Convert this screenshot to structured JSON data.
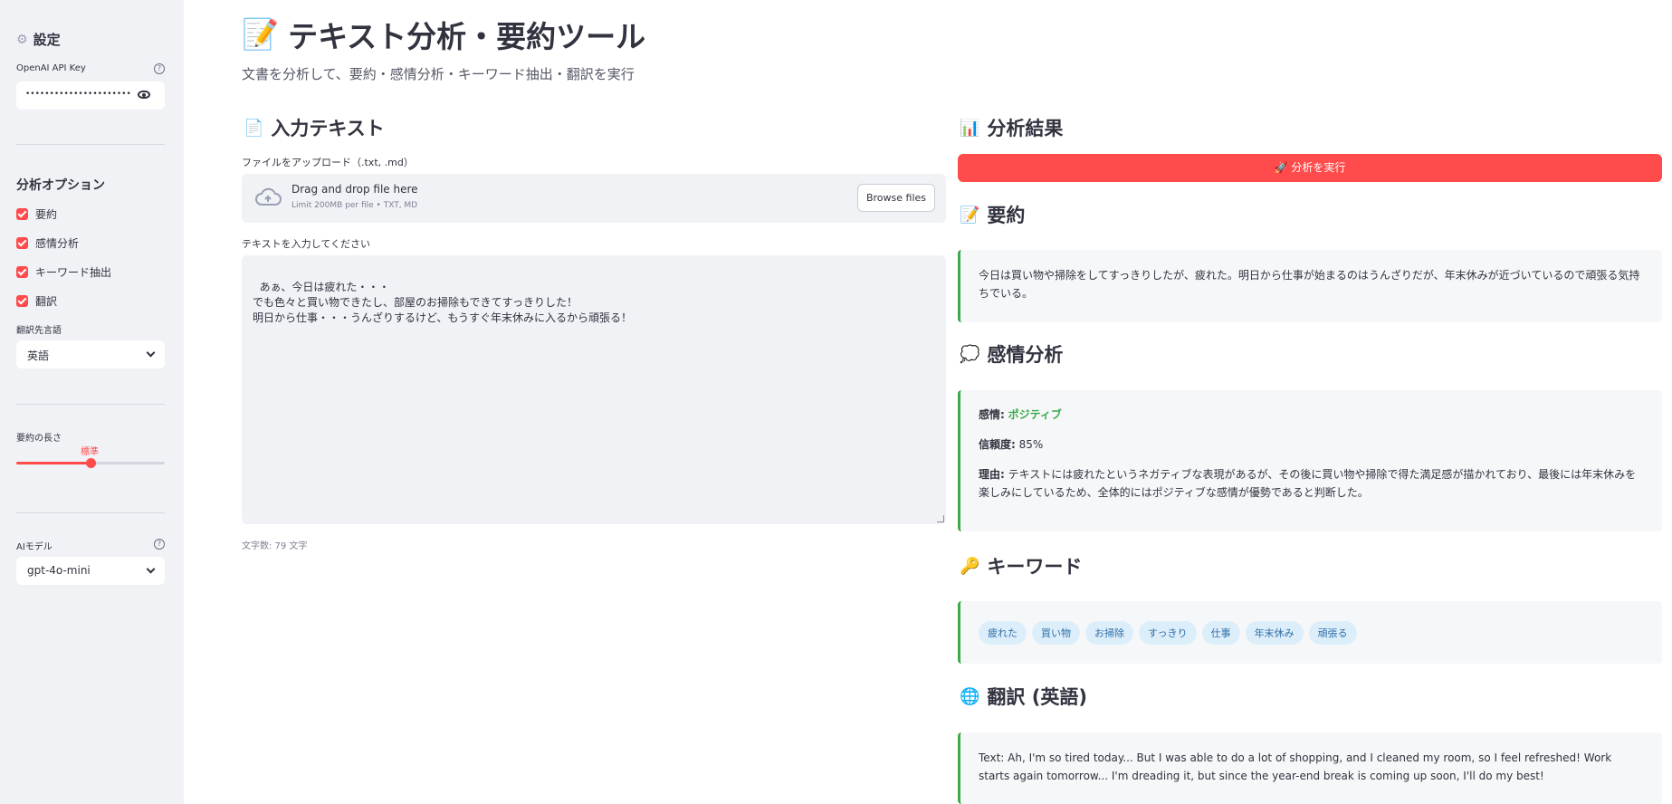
{
  "sidebar": {
    "title": "設定",
    "title_icon": "gear-icon",
    "api_key_label": "OpenAI API Key",
    "api_key_value": "••••••••••••••••••••••••••••••••",
    "help_glyph": "?",
    "options_heading": "分析オプション",
    "options": [
      {
        "label": "要約",
        "checked": true
      },
      {
        "label": "感情分析",
        "checked": true
      },
      {
        "label": "キーワード抽出",
        "checked": true
      },
      {
        "label": "翻訳",
        "checked": true
      }
    ],
    "target_lang_label": "翻訳先言語",
    "target_lang_value": "英語",
    "summary_length_label": "要約の長さ",
    "summary_length_value": "標準",
    "summary_length_position": 0.5,
    "model_label": "AIモデル",
    "model_value": "gpt-4o-mini"
  },
  "main": {
    "title_icon": "📝",
    "title": "テキスト分析・要約ツール",
    "subtitle": "文書を分析して、要約・感情分析・キーワード抽出・翻訳を実行",
    "input_heading_icon": "📄",
    "input_heading": "入力テキスト",
    "upload_label": "ファイルをアップロード（.txt, .md）",
    "dropzone_main": "Drag and drop file here",
    "dropzone_sub": "Limit 200MB per file • TXT, MD",
    "browse_button": "Browse files",
    "textarea_label": "テキストを入力してください",
    "textarea_value": "あぁ、今日は疲れた・・・\nでも色々と買い物できたし、部屋のお掃除もできてすっきりした！\n明日から仕事・・・うんざりするけど、もうすぐ年末休みに入るから頑張る！",
    "char_count": "文字数: 79 文字"
  },
  "results": {
    "heading_icon": "📊",
    "heading": "分析結果",
    "run_button": "🚀 分析を実行",
    "summary_icon": "📝",
    "summary_heading": "要約",
    "summary_text": "今日は買い物や掃除をしてすっきりしたが、疲れた。明日から仕事が始まるのはうんざりだが、年末休みが近づいているので頑張る気持ちでいる。",
    "sentiment_icon": "💭",
    "sentiment_heading": "感情分析",
    "sentiment_label": "感情:",
    "sentiment_value": "ポジティブ",
    "confidence_label": "信頼度:",
    "confidence_value": "85%",
    "reason_label": "理由:",
    "reason_text": "テキストには疲れたというネガティブな表現があるが、その後に買い物や掃除で得た満足感が描かれており、最後には年末休みを楽しみにしているため、全体的にはポジティブな感情が優勢であると判断した。",
    "keywords_icon": "🔑",
    "keywords_heading": "キーワード",
    "keywords": [
      "疲れた",
      "買い物",
      "お掃除",
      "すっきり",
      "仕事",
      "年末休み",
      "頑張る"
    ],
    "translation_icon": "🌐",
    "translation_heading": "翻訳 (英語)",
    "translation_text": "Text: Ah, I'm so tired today... But I was able to do a lot of shopping, and I cleaned my room, so I feel refreshed! Work starts again tomorrow... I'm dreading it, but since the year-end break is coming up soon, I'll do my best!"
  },
  "colors": {
    "accent": "#ff4b4b",
    "positive": "#3aaa4a",
    "chip_bg": "#ddeefb",
    "chip_text": "#2e6ea6"
  }
}
